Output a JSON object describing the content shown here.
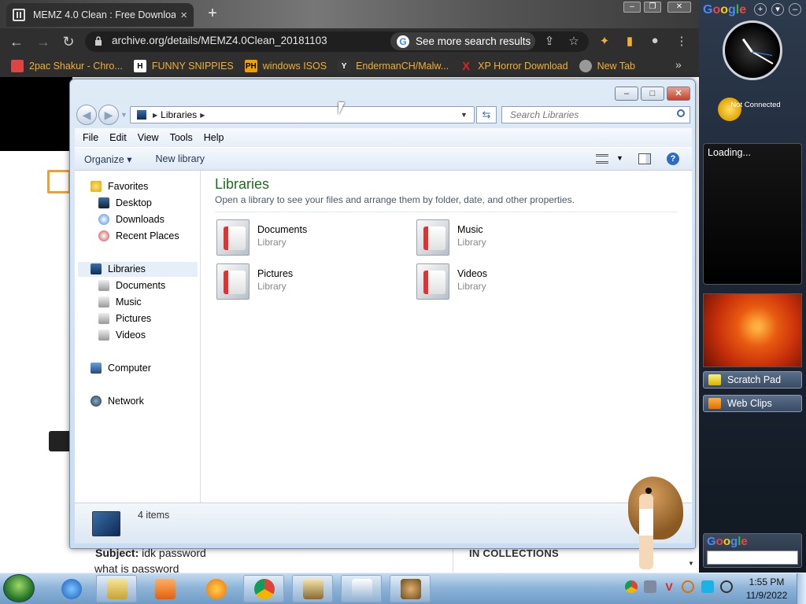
{
  "browser": {
    "tab_title": "MEMZ 4.0 Clean : Free Downloa...",
    "tab_close": "×",
    "new_tab": "+",
    "url": "archive.org/details/MEMZ4.0Clean_20181103",
    "see_more": "See more search results",
    "bookmarks": [
      {
        "label": "2pac Shakur - Chro...",
        "icon": "bookmark-2pac-icon",
        "color": "#d44"
      },
      {
        "label": "FUNNY SNIPPIES",
        "icon": "h-letter-icon",
        "color": "#fff"
      },
      {
        "label": "windows ISOS",
        "icon": "ph-letter-icon",
        "color": "#f0a000"
      },
      {
        "label": "EndermanCH/Malw...",
        "icon": "youtube-icon",
        "color": "#333"
      },
      {
        "label": "XP Horror Download",
        "icon": "x-mark-icon",
        "color": "#d22"
      },
      {
        "label": "New Tab",
        "icon": "globe-icon",
        "color": "#999"
      }
    ],
    "bookmarks_more": "»"
  },
  "page": {
    "subject_label": "Subject:",
    "subject_value": "idk password",
    "body": "what is password",
    "collections": "IN COLLECTIONS"
  },
  "explorer": {
    "breadcrumb": "Libraries",
    "search_placeholder": "Search Libraries",
    "menus": [
      "File",
      "Edit",
      "View",
      "Tools",
      "Help"
    ],
    "commands": {
      "organize": "Organize ▾",
      "new_library": "New library"
    },
    "nav": {
      "favorites": "Favorites",
      "favorites_items": [
        "Desktop",
        "Downloads",
        "Recent Places"
      ],
      "libraries": "Libraries",
      "libraries_items": [
        "Documents",
        "Music",
        "Pictures",
        "Videos"
      ],
      "computer": "Computer",
      "network": "Network"
    },
    "content_title": "Libraries",
    "content_subtitle": "Open a library to see your files and arrange them by folder, date, and other properties.",
    "libraries": [
      {
        "name": "Documents",
        "type": "Library"
      },
      {
        "name": "Music",
        "type": "Library"
      },
      {
        "name": "Pictures",
        "type": "Library"
      },
      {
        "name": "Videos",
        "type": "Library"
      }
    ],
    "status_count": "4 items"
  },
  "sidebar": {
    "google": "Google",
    "clock_status": "Not Connected",
    "loading": "Loading...",
    "scratch_pad": "Scratch Pad",
    "web_clips": "Web Clips",
    "google_search": "Google"
  },
  "taskbar": {
    "time": "1:55 PM",
    "date": "11/9/2022",
    "apps": [
      "internet-explorer-icon",
      "windows-explorer-icon",
      "media-player-icon",
      "uc-browser-icon",
      "chrome-icon",
      "memz-app-icon",
      "notepad-icon",
      "bonzi-box-icon"
    ]
  },
  "colors": {
    "chrome_toolbar": "#2f2f2f",
    "explorer_title": "#1f6b1f",
    "bookmark_text": "#f0b030"
  }
}
